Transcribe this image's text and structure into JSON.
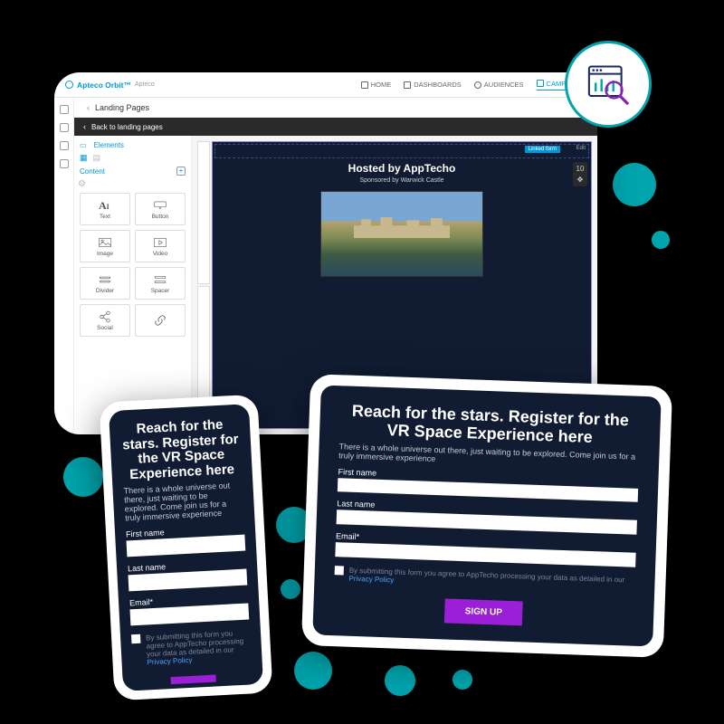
{
  "brand": {
    "name": "Apteco Orbit™",
    "sub": "Apteco"
  },
  "nav": {
    "home": "HOME",
    "dashboards": "DASHBOARDS",
    "audiences": "AUDIENCES",
    "campaigns": "CAMPAIGNS"
  },
  "breadcrumb": {
    "title": "Landing Pages"
  },
  "backbar": "Back to landing pages",
  "elements": {
    "tab_elements": "Elements",
    "heading": "Content",
    "items": {
      "text": "Text",
      "button": "Button",
      "image": "Image",
      "video": "Video",
      "divider": "Divider",
      "spacer": "Spacer",
      "social": "Social"
    }
  },
  "preview": {
    "badge": "Linked form",
    "edit": "Edit",
    "title": "Hosted by AppTecho",
    "sponsor": "Sponsored by Warwick Castle",
    "count": "10"
  },
  "form": {
    "heading_mobile": "Reach for the stars. Register for the VR Space Experience here",
    "heading_tablet": "Reach for the stars. Register for the VR Space Experience here",
    "desc": "There is a whole universe out there, just waiting to be explored. Come join us for a truly immersive experience",
    "first_name": "First name",
    "last_name": "Last name",
    "email": "Email*",
    "consent_pre": "By submitting this form you agree to AppTecho processing your data as detailed in our ",
    "privacy": "Privacy Policy",
    "signup": "SIGN UP"
  }
}
